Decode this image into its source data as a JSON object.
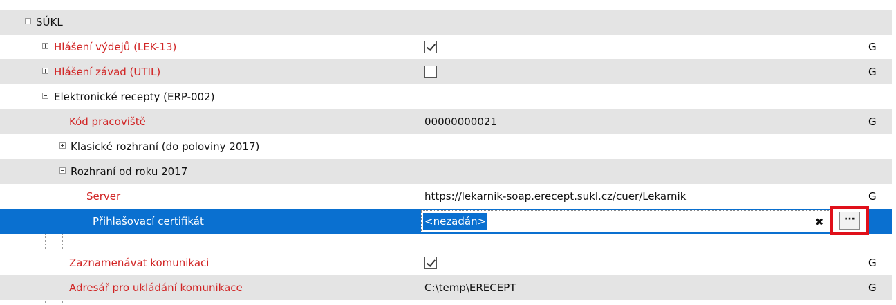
{
  "tree": {
    "rows": [
      {
        "label": "SÚKL",
        "value": "",
        "scope": ""
      },
      {
        "label": "Hlášení výdejů (LEK-13)",
        "value": "",
        "scope": "G"
      },
      {
        "label": "Hlášení závad (UTIL)",
        "value": "",
        "scope": "G"
      },
      {
        "label": "Elektronické recepty (ERP-002)",
        "value": "",
        "scope": ""
      },
      {
        "label": "Kód pracoviště",
        "value": "00000000021",
        "scope": "G"
      },
      {
        "label": "Klasické rozhraní (do poloviny 2017)",
        "value": "",
        "scope": ""
      },
      {
        "label": "Rozhraní od roku 2017",
        "value": "",
        "scope": ""
      },
      {
        "label": "Server",
        "value": "https://lekarnik-soap.erecept.sukl.cz/cuer/Lekarnik",
        "scope": "G"
      },
      {
        "label": "Přihlašovací certifikát",
        "value": "<nezadán>",
        "scope": ""
      },
      {
        "label": "Zaznamenávat komunikaci",
        "value": "",
        "scope": "G"
      },
      {
        "label": "Adresář pro ukládání komunikace",
        "value": "C:\\temp\\ERECEPT",
        "scope": "G"
      }
    ],
    "checkboxes": {
      "hlaseni_vydeju": true,
      "hlaseni_zavad": false,
      "zaznamenavat_komunikaci": true
    },
    "editor": {
      "clear_symbol": "✖",
      "browse_symbol": "···"
    }
  },
  "colors": {
    "row_shade": "#e4e4e4",
    "selection": "#0a70d0",
    "required_label": "#d12424",
    "highlight_frame": "#e0101a"
  },
  "icons": {
    "expander_collapsed": "plus-box-icon",
    "expander_expanded": "minus-box-icon",
    "clear": "clear-x-icon",
    "browse": "ellipsis-icon"
  }
}
